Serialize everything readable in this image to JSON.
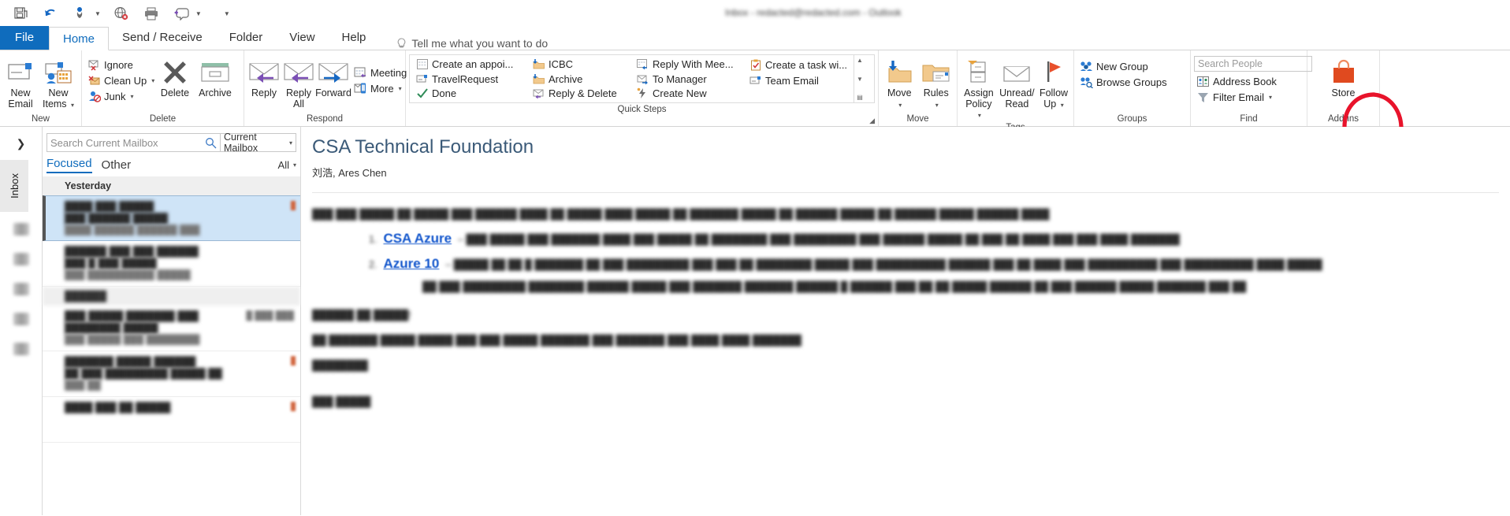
{
  "quick_access": {
    "icons": [
      "save-icon",
      "undo-icon",
      "touch-mode-icon",
      "offline-icon",
      "print-icon",
      "reply-all-icon",
      "customize-icon"
    ],
    "title_redacted": "Inbox - redacted@redacted.com - Outlook"
  },
  "tabs": [
    {
      "label": "File",
      "active": false,
      "style": "file"
    },
    {
      "label": "Home",
      "active": true
    },
    {
      "label": "Send / Receive",
      "active": false
    },
    {
      "label": "Folder",
      "active": false
    },
    {
      "label": "View",
      "active": false
    },
    {
      "label": "Help",
      "active": false
    }
  ],
  "tellme": "Tell me what you want to do",
  "ribbon": {
    "groups": [
      {
        "name": "New",
        "label": "New",
        "big_buttons": [
          {
            "label": "New\nEmail",
            "icon": "new-email-icon"
          },
          {
            "label": "New\nItems",
            "icon": "new-items-icon",
            "dropdown": true
          }
        ]
      },
      {
        "name": "Delete",
        "label": "Delete",
        "small_buttons": [
          {
            "label": "Ignore",
            "icon": "ignore-icon"
          },
          {
            "label": "Clean Up",
            "icon": "clean-up-icon",
            "dropdown": true
          },
          {
            "label": "Junk",
            "icon": "junk-icon",
            "dropdown": true
          }
        ],
        "big_buttons": [
          {
            "label": "Delete",
            "icon": "delete-x-icon"
          },
          {
            "label": "Archive",
            "icon": "archive-icon"
          }
        ]
      },
      {
        "name": "Respond",
        "label": "Respond",
        "big_buttons": [
          {
            "label": "Reply",
            "icon": "reply-icon"
          },
          {
            "label": "Reply\nAll",
            "icon": "reply-all-icon"
          },
          {
            "label": "Forward",
            "icon": "forward-icon"
          }
        ],
        "small_buttons": [
          {
            "label": "Meeting",
            "icon": "meeting-icon"
          },
          {
            "label": "More",
            "icon": "more-icon",
            "dropdown": true
          }
        ]
      },
      {
        "name": "QuickSteps",
        "label": "Quick Steps",
        "quick_steps": [
          [
            {
              "label": "Create an appoi...",
              "icon": "appointment-icon"
            },
            {
              "label": "TravelRequest",
              "icon": "email-template-icon"
            },
            {
              "label": "Done",
              "icon": "done-check-icon"
            }
          ],
          [
            {
              "label": "ICBC",
              "icon": "move-folder-icon"
            },
            {
              "label": "Archive",
              "icon": "move-folder-icon"
            },
            {
              "label": "Reply & Delete",
              "icon": "reply-delete-icon"
            }
          ],
          [
            {
              "label": "Reply With Mee...",
              "icon": "reply-meeting-icon"
            },
            {
              "label": "To Manager",
              "icon": "to-manager-icon"
            },
            {
              "label": "Create New",
              "icon": "create-new-icon"
            }
          ],
          [
            {
              "label": "Create a task wi...",
              "icon": "task-icon"
            },
            {
              "label": "Team Email",
              "icon": "team-email-icon"
            }
          ]
        ],
        "scroll": [
          "▲",
          "▼",
          "▤"
        ]
      },
      {
        "name": "Move",
        "label": "Move",
        "big_buttons": [
          {
            "label": "Move",
            "icon": "move-icon",
            "dropdown": true
          },
          {
            "label": "Rules",
            "icon": "rules-icon",
            "dropdown": true
          }
        ]
      },
      {
        "name": "Tags",
        "label": "Tags",
        "big_buttons": [
          {
            "label": "Assign\nPolicy",
            "icon": "assign-policy-icon",
            "dropdown": true
          },
          {
            "label": "Unread/\nRead",
            "icon": "unread-read-icon"
          },
          {
            "label": "Follow\nUp",
            "icon": "follow-up-flag-icon",
            "dropdown": true
          }
        ]
      },
      {
        "name": "Groups",
        "label": "Groups",
        "small_buttons": [
          {
            "label": "New Group",
            "icon": "new-group-icon"
          },
          {
            "label": "Browse Groups",
            "icon": "browse-groups-icon"
          }
        ]
      },
      {
        "name": "Find",
        "label": "Find",
        "search_people_placeholder": "Search People",
        "small_buttons": [
          {
            "label": "Address Book",
            "icon": "address-book-icon"
          },
          {
            "label": "Filter Email",
            "icon": "filter-email-icon",
            "dropdown": true
          }
        ]
      },
      {
        "name": "Addins",
        "label": "Add-ins",
        "big_buttons": [
          {
            "label": "Store",
            "icon": "store-icon"
          }
        ]
      }
    ]
  },
  "annotation": {
    "type": "red-circle",
    "color": "#e8132b",
    "target": "Store"
  },
  "nav_rail": {
    "expand_icon": "chevron-right-icon",
    "inbox_label": "Inbox"
  },
  "list_pane": {
    "search_placeholder": "Search Current Mailbox",
    "search_icon": "search-icon",
    "scope": "Current Mailbox",
    "scope_caret": "chevron-down-icon",
    "tab_focused": "Focused",
    "tab_other": "Other",
    "filter_all": "All",
    "group_header": "Yesterday",
    "messages": [
      {
        "sender_redacted": "████ ███ █████",
        "subject_redacted": "███ ██████ █████",
        "preview_redacted": "████ ██████ ██████ ███",
        "time_redacted": "██ ██ ████",
        "selected": true,
        "flag": true
      },
      {
        "sender_redacted": "██████ ███ ███ ██████",
        "subject_redacted": "███ █ ███ █████",
        "preview_redacted": "███ ██████████ █████",
        "time_redacted": "█ █ ████",
        "selected": false,
        "flag": false
      }
    ],
    "group_header_2_redacted": "██████",
    "messages_2": [
      {
        "sender_redacted": "███ █████ ███████ ███",
        "subject_redacted": "████████ █████",
        "preview_redacted": "███ █████ ███ ████████",
        "time_redacted": "█ ███ ███",
        "selected": false,
        "flag": false
      },
      {
        "sender_redacted": "███████ █████ ██████",
        "subject_redacted": "██ ███ █████████ █████ ██",
        "preview_redacted": "███ ██",
        "time_redacted": "██ ██ ███",
        "selected": false,
        "flag": true
      },
      {
        "sender_redacted": "████ ███ ██ █████",
        "subject_redacted": "",
        "preview_redacted": "",
        "time_redacted": "",
        "selected": false,
        "flag": true
      }
    ]
  },
  "reading_pane": {
    "subject": "CSA Technical Foundation",
    "senders": "刘浩, Ares Chen",
    "body": {
      "intro_redacted": "███ ███ █████ ██ █████ ███ ██████ ████ ██ █████ ████ █████ ██ ███████ █████ ██ ██████ █████ ██ ██████ █████ ██████ ████",
      "items": [
        {
          "number_redacted": "1.",
          "link": "CSA Azure",
          "tail_redacted": "– ███ █████ ███ ███████ ████ ███ █████ ██ ████████ ███ █████████ ███ ██████ █████ ██ ███ ██ ████ ███ ███ ████ ███████"
        },
        {
          "number_redacted": "2.",
          "link": "Azure 10",
          "tail_redacted": "– █████ ██ ██ █ ███████ ██ ███ █████████ ███ ███ ██ ████████ █████ ███ ██████████ ██████ ███ ██ ████ ███ ██████████ ███ ██████████ ████ █████"
        },
        {
          "number_redacted": "",
          "link": "",
          "tail_redacted": "██ ███ █████████ ████████ ██████ █████ ███ ███████ ███████ ██████ █ ██████ ███ ██ ██ █████ ██████ ██ ███ ██████ █████ ███████ ███ ██"
        }
      ],
      "p2_redacted": "██████ ██ █████!",
      "p3_redacted": "██ ███████ █████ █████ ███ ███ █████ ███████ ███ ███████ ███ ████ ████ ███████",
      "p4_redacted": "████████",
      "p5_redacted": "███ █████"
    }
  },
  "colors": {
    "accent_blue": "#0f6cbd",
    "link_blue": "#1155cc",
    "annotation_red": "#e8132b",
    "store_orange": "#e04a1f",
    "folder_tan": "#f2c98c",
    "selection_blue": "#cfe4f7"
  }
}
